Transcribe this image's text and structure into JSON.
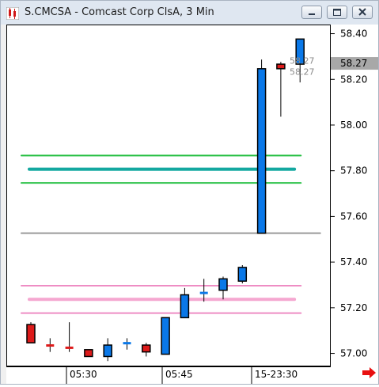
{
  "window": {
    "title": "S.CMCSA - Comcast Corp ClsA, 3 Min",
    "buttons": [
      "minimize",
      "restore",
      "close"
    ]
  },
  "chart_data": {
    "type": "candlestick",
    "symbol": "S.CMCSA",
    "interval": "3 Min",
    "price_axis": {
      "ticks": [
        "58.40",
        "58.20",
        "58.00",
        "57.80",
        "57.60",
        "57.40",
        "57.20",
        "57.00"
      ],
      "ylim": [
        56.95,
        58.44
      ],
      "current_price_label": "58.27"
    },
    "time_axis": {
      "labels": [
        "05:30",
        "05:45",
        "15-23:30"
      ]
    },
    "candles": [
      {
        "o": 57.13,
        "h": 57.14,
        "l": 57.05,
        "c": 57.05,
        "color": "red"
      },
      {
        "o": 57.04,
        "h": 57.07,
        "l": 57.01,
        "c": 57.04,
        "color": "red"
      },
      {
        "o": 57.03,
        "h": 57.14,
        "l": 57.01,
        "c": 57.02,
        "color": "red"
      },
      {
        "o": 57.02,
        "h": 57.02,
        "l": 56.99,
        "c": 56.99,
        "color": "red"
      },
      {
        "o": 56.99,
        "h": 57.07,
        "l": 56.97,
        "c": 57.04,
        "color": "blue"
      },
      {
        "o": 57.05,
        "h": 57.07,
        "l": 57.02,
        "c": 57.05,
        "color": "blue"
      },
      {
        "o": 57.04,
        "h": 57.05,
        "l": 56.99,
        "c": 57.01,
        "color": "red"
      },
      {
        "o": 57.0,
        "h": 57.16,
        "l": 57.0,
        "c": 57.16,
        "color": "blue"
      },
      {
        "o": 57.16,
        "h": 57.29,
        "l": 57.16,
        "c": 57.26,
        "color": "blue"
      },
      {
        "o": 57.26,
        "h": 57.33,
        "l": 57.23,
        "c": 57.27,
        "color": "blue"
      },
      {
        "o": 57.28,
        "h": 57.34,
        "l": 57.24,
        "c": 57.33,
        "color": "blue"
      },
      {
        "o": 57.32,
        "h": 57.39,
        "l": 57.31,
        "c": 57.38,
        "color": "blue"
      },
      {
        "o": 57.53,
        "h": 58.29,
        "l": 57.53,
        "c": 58.25,
        "color": "blue"
      },
      {
        "o": 58.27,
        "h": 58.28,
        "l": 58.04,
        "c": 58.25,
        "color": "red"
      },
      {
        "o": 58.27,
        "h": 58.38,
        "l": 58.19,
        "c": 58.38,
        "color": "blue"
      }
    ],
    "overlay_labels": [
      "58.27",
      "58.27"
    ],
    "reference_lines": [
      {
        "y": 57.87,
        "color": "#2ec24a",
        "style": "thin",
        "x_end": 0.91
      },
      {
        "y": 57.81,
        "color": "#14a8a0",
        "style": "thick",
        "x_end": 0.89
      },
      {
        "y": 57.75,
        "color": "#2ec24a",
        "style": "thin",
        "x_end": 0.91
      },
      {
        "y": 57.53,
        "color": "#9a9a9a",
        "style": "thin",
        "x_end": 0.97
      },
      {
        "y": 57.3,
        "color": "#ee8dc4",
        "style": "thin",
        "x_end": 0.91
      },
      {
        "y": 57.24,
        "color": "#f5a7d0",
        "style": "thick",
        "x_end": 0.89
      },
      {
        "y": 57.18,
        "color": "#ee8dc4",
        "style": "thin",
        "x_end": 0.91
      }
    ],
    "grid": false,
    "colors": {
      "up": "#0a78e8",
      "down": "#dd1a1a",
      "next_arrow": "#e81010"
    }
  }
}
